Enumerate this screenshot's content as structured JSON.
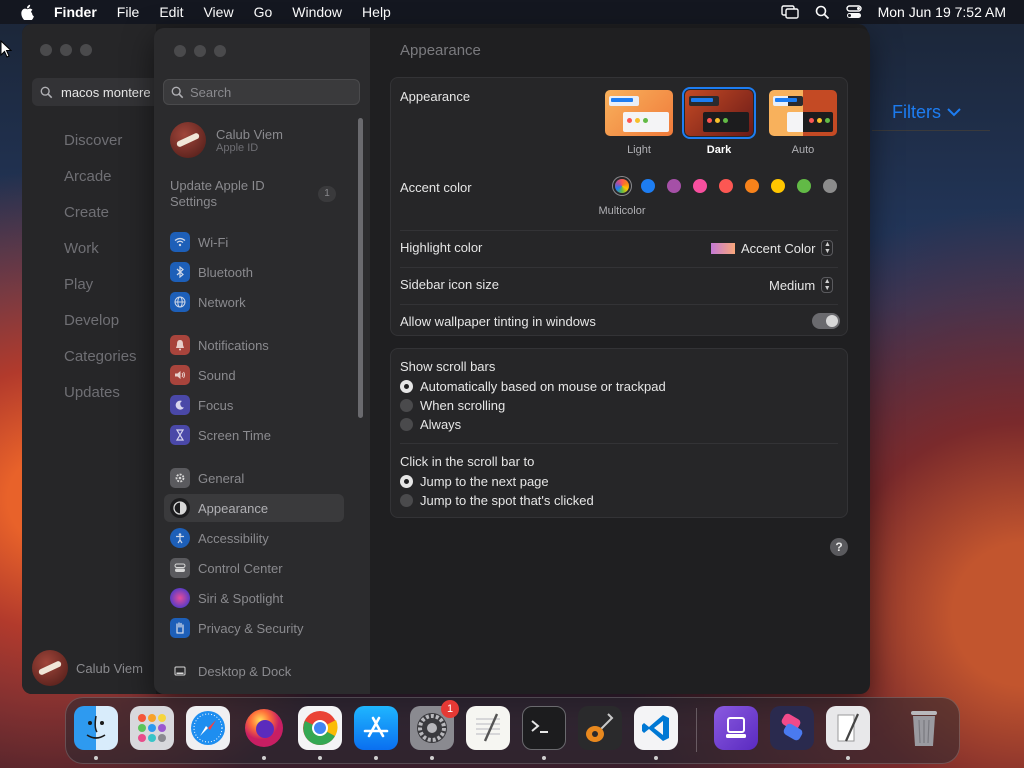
{
  "menubar": {
    "app": "Finder",
    "items": [
      "File",
      "Edit",
      "View",
      "Go",
      "Window",
      "Help"
    ],
    "clock": "Mon Jun 19  7:52 AM"
  },
  "appstore": {
    "search_value": "macos montere",
    "nav": [
      "Discover",
      "Arcade",
      "Create",
      "Work",
      "Play",
      "Develop",
      "Categories",
      "Updates"
    ],
    "user": "Calub Viem",
    "filters": "Filters"
  },
  "settings": {
    "search_placeholder": "Search",
    "profile": {
      "name": "Calub Viem",
      "sub": "Apple ID"
    },
    "update": {
      "line1": "Update Apple ID",
      "line2": "Settings",
      "badge": "1"
    },
    "sidebar": [
      {
        "label": "Wi-Fi",
        "icon": "wifi-icon",
        "color": "#1d7df2"
      },
      {
        "label": "Bluetooth",
        "icon": "bluetooth-icon",
        "color": "#1d7df2"
      },
      {
        "label": "Network",
        "icon": "globe-icon",
        "color": "#1d7df2"
      },
      {
        "label": "Notifications",
        "icon": "bell-icon",
        "color": "#e5473b"
      },
      {
        "label": "Sound",
        "icon": "speaker-icon",
        "color": "#e5473b"
      },
      {
        "label": "Focus",
        "icon": "moon-icon",
        "color": "#5e5ce6"
      },
      {
        "label": "Screen Time",
        "icon": "hourglass-icon",
        "color": "#5e5ce6"
      },
      {
        "label": "General",
        "icon": "gear-icon",
        "color": "#8e8e93"
      },
      {
        "label": "Appearance",
        "icon": "appearance-icon",
        "color": "#1c1c1e"
      },
      {
        "label": "Accessibility",
        "icon": "accessibility-icon",
        "color": "#1d7df2"
      },
      {
        "label": "Control Center",
        "icon": "control-center-icon",
        "color": "#8e8e93"
      },
      {
        "label": "Siri & Spotlight",
        "icon": "siri-icon",
        "color": "#b55de0"
      },
      {
        "label": "Privacy & Security",
        "icon": "hand-icon",
        "color": "#1d7df2"
      },
      {
        "label": "Desktop & Dock",
        "icon": "dock-icon",
        "color": "#2c2c2e"
      }
    ],
    "selected": "Appearance",
    "title": "Appearance",
    "appearance": {
      "label": "Appearance",
      "options": [
        "Light",
        "Dark",
        "Auto"
      ],
      "selected": "Dark"
    },
    "accent": {
      "label": "Accent color",
      "caption": "Multicolor",
      "colors": [
        "multicolor",
        "#1d7df2",
        "#a550a7",
        "#f74f9e",
        "#fc5753",
        "#f7821b",
        "#ffc600",
        "#62ba46",
        "#8c8c8c"
      ]
    },
    "highlight": {
      "label": "Highlight color",
      "value": "Accent Color"
    },
    "icon_size": {
      "label": "Sidebar icon size",
      "value": "Medium"
    },
    "tinting": {
      "label": "Allow wallpaper tinting in windows",
      "on": false
    },
    "scroll_bars": {
      "label": "Show scroll bars",
      "options": [
        "Automatically based on mouse or trackpad",
        "When scrolling",
        "Always"
      ],
      "selected": 0
    },
    "click_scroll": {
      "label": "Click in the scroll bar to",
      "options": [
        "Jump to the next page",
        "Jump to the spot that's clicked"
      ],
      "selected": 0
    },
    "help": "?"
  },
  "dock": {
    "apps": [
      "Finder",
      "Launchpad",
      "Safari",
      "Firefox",
      "Chrome",
      "App Store",
      "System Settings",
      "TextEdit",
      "Terminal",
      "GarageBand",
      "Visual Studio Code",
      "Apple Configurator",
      "Shortcuts",
      "Script Editor",
      "Trash"
    ],
    "settings_badge": "1"
  }
}
